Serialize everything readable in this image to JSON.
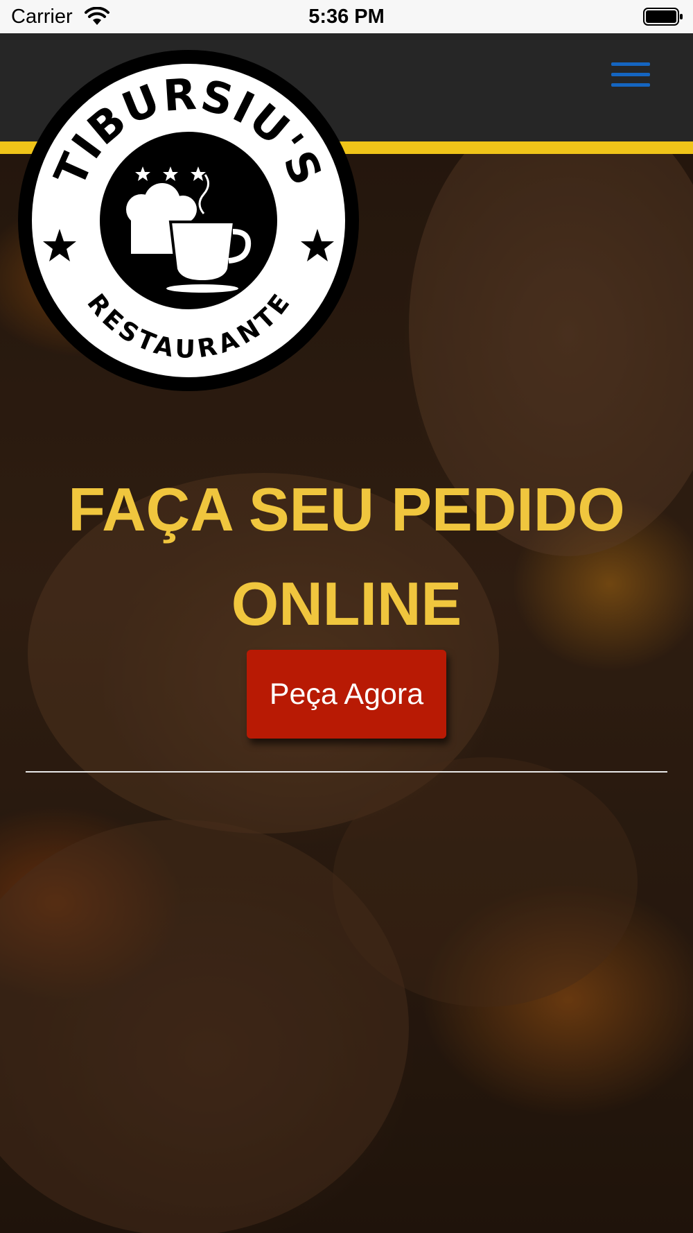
{
  "status_bar": {
    "carrier": "Carrier",
    "time": "5:36 PM",
    "wifi_icon": "wifi-icon",
    "battery_icon": "battery-icon"
  },
  "header": {
    "menu_icon": "hamburger-menu-icon",
    "menu_color": "#1565c0",
    "stripe_color": "#f0c419"
  },
  "logo": {
    "name_text": "TIBURSIU'S",
    "subtitle_text": "RESTAURANTE",
    "icon": "chef-hat-and-coffee-cup-icon"
  },
  "hero": {
    "headline_line1": "FAÇA SEU PEDIDO",
    "headline_line2": "ONLINE",
    "headline_color": "#f0c63e",
    "cta_label": "Peça Agora",
    "cta_color": "#b81a04"
  }
}
